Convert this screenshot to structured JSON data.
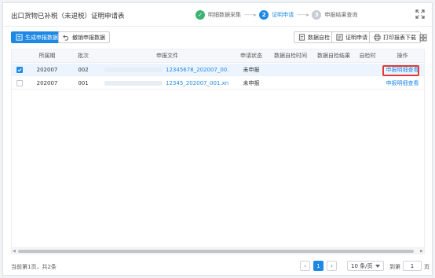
{
  "header": {
    "title": "出口货物已补税（未退税）证明申请表",
    "steps": [
      {
        "label": "明细数据采集",
        "state": "done",
        "marker": "✓"
      },
      {
        "label": "证明申请",
        "state": "active",
        "marker": "2"
      },
      {
        "label": "申报结果查询",
        "state": "pending",
        "marker": "3"
      }
    ],
    "step_separator": "------▸"
  },
  "toolbar": {
    "generate_label": "生成申报数据",
    "revoke_label": "撤销申报数据",
    "self_check_label": "数据自检",
    "apply_label": "证明申请",
    "print_label": "打印报表下载"
  },
  "table": {
    "columns": [
      "所属期",
      "批次",
      "申报文件",
      "申请状态",
      "数据自检时间",
      "数据自检结果",
      "自检时",
      "操作"
    ],
    "rows": [
      {
        "selected": true,
        "period": "202007",
        "batch": "002",
        "file": "12345678_202007_00.",
        "status": "未申报",
        "check_time": "",
        "check_result": "",
        "checker": "",
        "action": "申报明细查看"
      },
      {
        "selected": false,
        "period": "202007",
        "batch": "001",
        "file": "12345_202007_001.xn",
        "status": "未申报",
        "check_time": "",
        "check_result": "",
        "checker": "",
        "action": "申报明细查看"
      }
    ]
  },
  "pagination": {
    "summary": "当前第1页，共2条",
    "prev": "‹",
    "current_page": "1",
    "next": "›",
    "page_size": "10 条/页",
    "goto_label": "到第",
    "goto_value": "1",
    "goto_suffix": "页"
  },
  "colors": {
    "accent": "#1e88e5",
    "done": "#3cb371",
    "highlight": "#e53935"
  }
}
